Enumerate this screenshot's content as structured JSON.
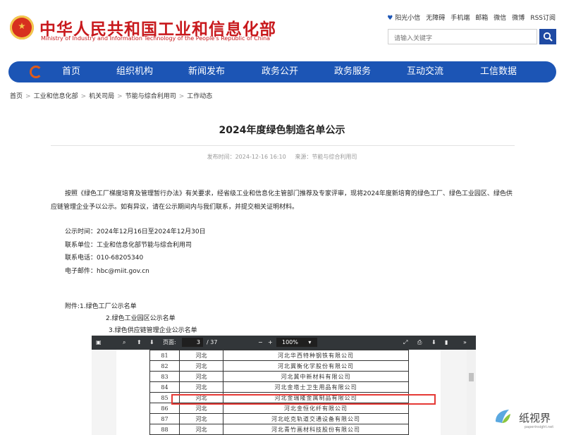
{
  "header": {
    "title_cn": "中华人民共和国工业和信息化部",
    "title_en": "Ministry of Industry and Information Technology of the People's Republic of China",
    "links": [
      "阳光小信",
      "无障碍",
      "手机端",
      "邮箱",
      "微信",
      "微博",
      "RSS订阅"
    ],
    "search_placeholder": "请输入关键字"
  },
  "nav": {
    "items": [
      "首页",
      "组织机构",
      "新闻发布",
      "政务公开",
      "政务服务",
      "互动交流",
      "工信数据"
    ]
  },
  "breadcrumb": [
    "首页",
    "工业和信息化部",
    "机关司局",
    "节能与综合利用司",
    "工作动态"
  ],
  "article": {
    "title": "2024年度绿色制造名单公示",
    "meta_time_label": "发布时间：",
    "meta_time": "2024-12-16 16:10",
    "meta_source_label": "来源：",
    "meta_source": "节能与综合利用司",
    "paragraph": "按照《绿色工厂梯度培育及管理暂行办法》有关要求，经省级工业和信息化主管部门推荐及专家评审，现将2024年度新培育的绿色工厂、绿色工业园区、绿色供应链管理企业予以公示。如有异议，请在公示期间内与我们联系，并提交相关证明材料。",
    "contact": [
      "公示时间：2024年12月16日至2024年12月30日",
      "联系单位：工业和信息化部节能与综合利用司",
      "联系电话：010-68205340",
      "电子邮件：hbc@miit.gov.cn"
    ],
    "attachments": [
      "附件:1.绿色工厂公示名单",
      "2.绿色工业园区公示名单",
      "3.绿色供应链管理企业公示名单"
    ]
  },
  "pdf_viewer": {
    "page_label": "页面:",
    "current_page": "3",
    "total_pages": "/ 37",
    "zoom": "100%",
    "rows": [
      {
        "no": "81",
        "province": "河北",
        "name": "河北华西特种钢铁有限公司"
      },
      {
        "no": "82",
        "province": "河北",
        "name": "河北冀衡化学股份有限公司"
      },
      {
        "no": "83",
        "province": "河北",
        "name": "河北冀中新材料有限公司"
      },
      {
        "no": "84",
        "province": "河北",
        "name": "河北金塔士卫生用品有限公司"
      },
      {
        "no": "85",
        "province": "河北",
        "name": "河北金瑞隆金属制品有限公司"
      },
      {
        "no": "86",
        "province": "河北",
        "name": "河北金恒化纤有限公司"
      },
      {
        "no": "87",
        "province": "河北",
        "name": "河北屹克轨道交通设备有限公司"
      },
      {
        "no": "88",
        "province": "河北",
        "name": "河北青竹画材科技股份有限公司"
      }
    ]
  },
  "watermark": {
    "cn": "纸视界",
    "en": "paperinsight.net"
  },
  "colors": {
    "brand_red": "#c8191d",
    "nav_blue": "#1c55b5",
    "highlight_red": "#e53935"
  }
}
